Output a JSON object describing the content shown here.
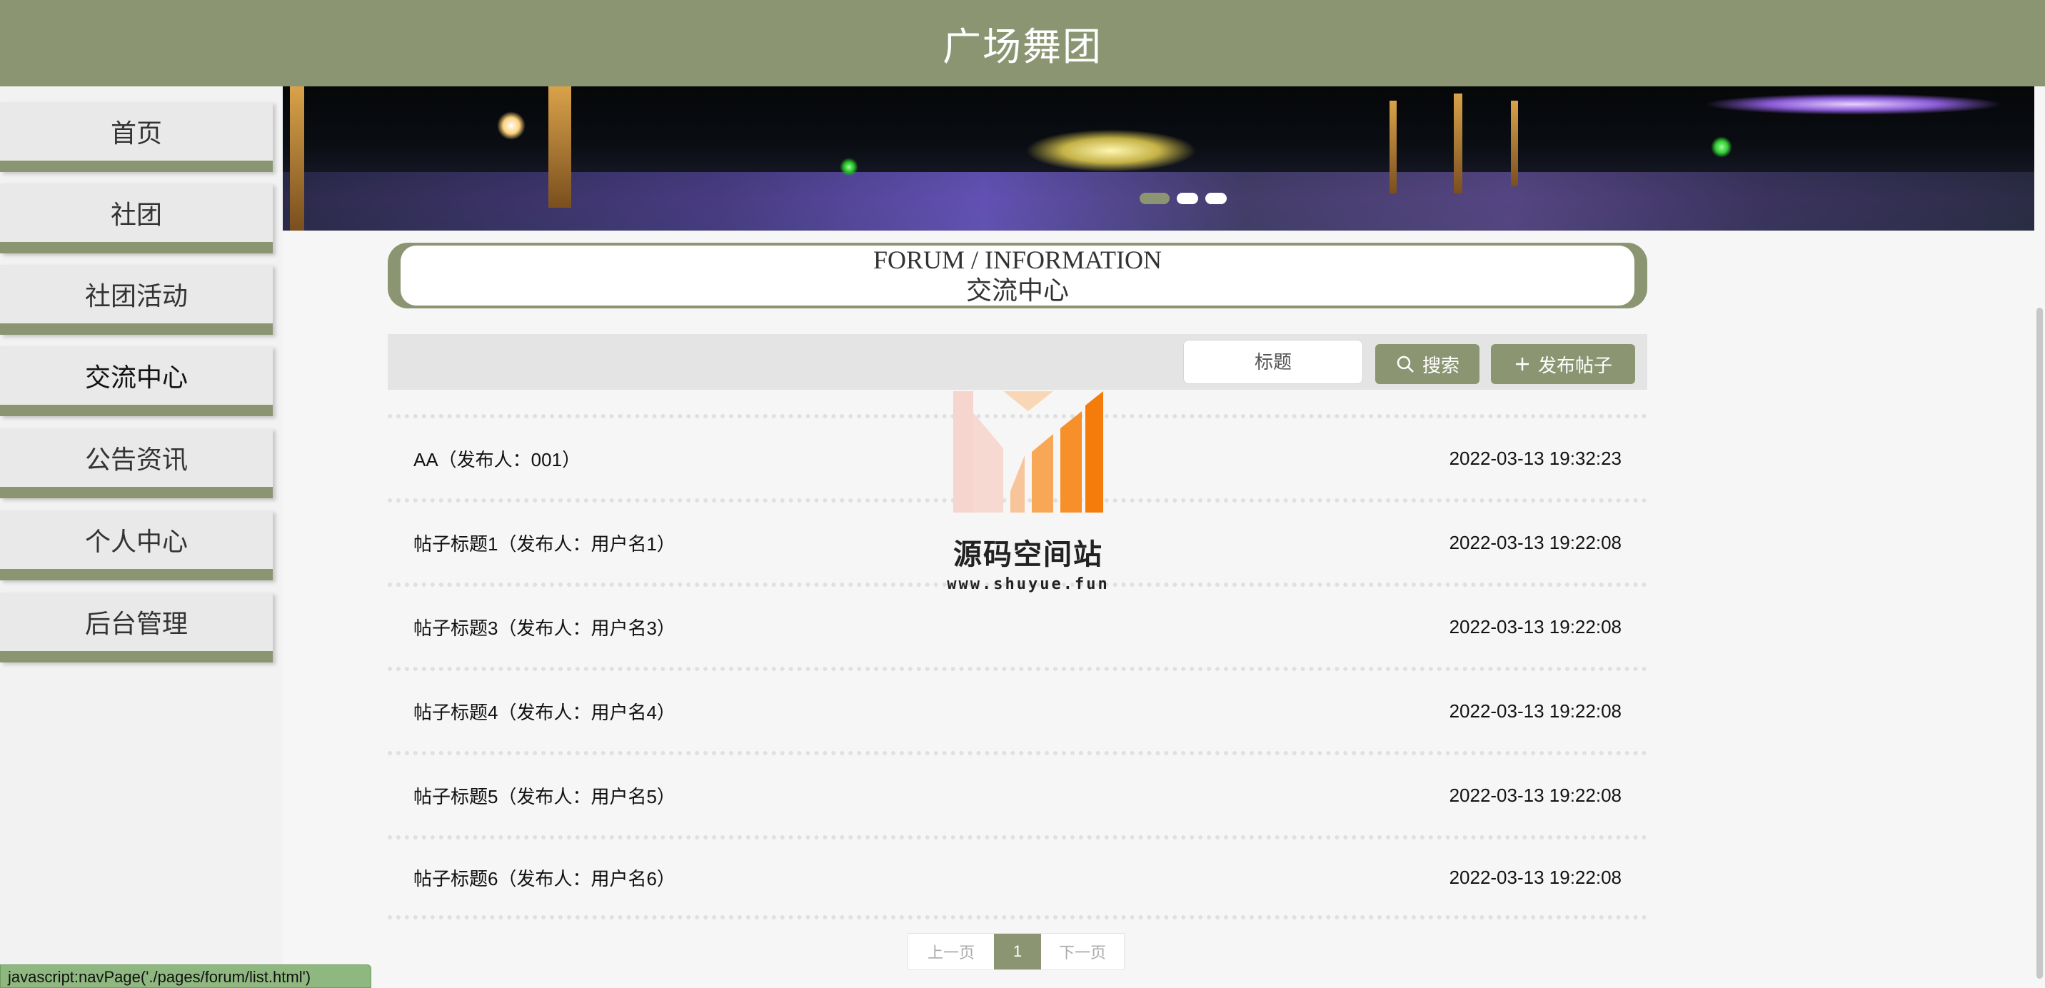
{
  "header": {
    "title": "广场舞团"
  },
  "sidebar": {
    "items": [
      {
        "label": "首页"
      },
      {
        "label": "社团"
      },
      {
        "label": "社团活动"
      },
      {
        "label": "交流中心"
      },
      {
        "label": "公告资讯"
      },
      {
        "label": "个人中心"
      },
      {
        "label": "后台管理"
      }
    ],
    "active_index": 3
  },
  "banner": {
    "slide_count": 3,
    "active_slide": 1
  },
  "section": {
    "title_en": "FORUM / INFORMATION",
    "title_zh": "交流中心"
  },
  "search": {
    "placeholder": "标题",
    "search_label": "搜索",
    "publish_label": "发布帖子"
  },
  "posts": [
    {
      "title": "AA（发布人：001）",
      "time": "2022-03-13 19:32:23"
    },
    {
      "title": "帖子标题1（发布人：用户名1）",
      "time": "2022-03-13 19:22:08"
    },
    {
      "title": "帖子标题3（发布人：用户名3）",
      "time": "2022-03-13 19:22:08"
    },
    {
      "title": "帖子标题4（发布人：用户名4）",
      "time": "2022-03-13 19:22:08"
    },
    {
      "title": "帖子标题5（发布人：用户名5）",
      "time": "2022-03-13 19:22:08"
    },
    {
      "title": "帖子标题6（发布人：用户名6）",
      "time": "2022-03-13 19:22:08"
    }
  ],
  "pagination": {
    "prev": "上一页",
    "current": "1",
    "next": "下一页"
  },
  "watermark": {
    "name": "源码空间站",
    "url": "www.shuyue.fun"
  },
  "status_bar": {
    "text": "javascript:navPage('./pages/forum/list.html')"
  },
  "colors": {
    "primary": "#8b9572",
    "background": "#f6f6f6"
  }
}
